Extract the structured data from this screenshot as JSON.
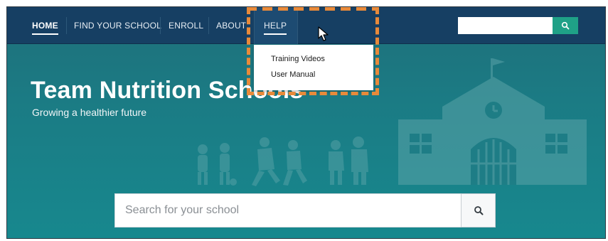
{
  "nav": {
    "items": [
      {
        "label": "HOME",
        "active": true
      },
      {
        "label": "FIND YOUR SCHOOL",
        "active": false
      },
      {
        "label": "ENROLL",
        "active": false
      },
      {
        "label": "ABOUT",
        "active": false
      },
      {
        "label": "HELP",
        "active": false
      }
    ],
    "search": {
      "placeholder": "",
      "value": "",
      "button_icon": "search-icon"
    }
  },
  "help_menu": {
    "items": [
      "Training Videos",
      "User Manual"
    ]
  },
  "hero": {
    "title": "Team Nutrition Schools",
    "subtitle": "Growing a healthier future"
  },
  "main_search": {
    "placeholder": "Search for your school",
    "button_icon": "search-icon"
  },
  "colors": {
    "nav_bg": "#163f63",
    "hero_bg": "#1b7b84",
    "search_button": "#1fa187",
    "highlight": "#e88a3a"
  }
}
